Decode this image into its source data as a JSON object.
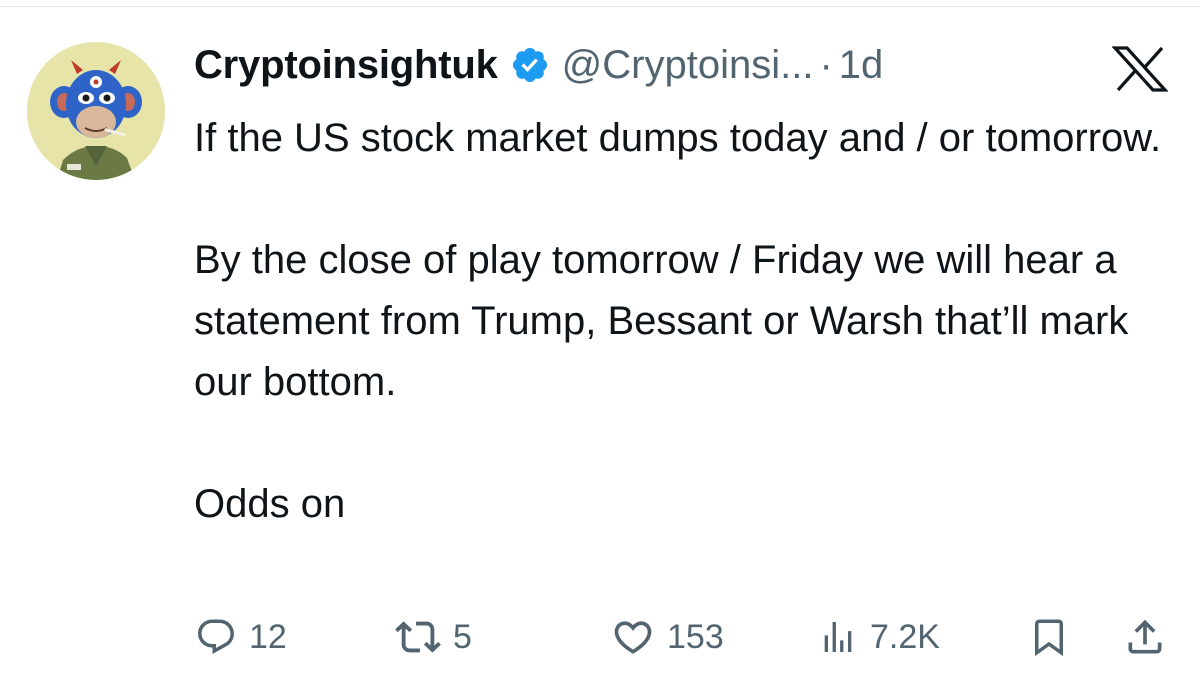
{
  "tweet": {
    "author_name": "Cryptoinsightuk",
    "handle": "@Cryptoinsi...",
    "separator": "·",
    "time": "1d",
    "paragraphs": [
      "If the US stock market dumps today and / or tomorrow.",
      "By the close of play tomorrow / Friday we will hear a statement from Trump, Bessant or Warsh that’ll mark our bottom.",
      "Odds on"
    ]
  },
  "actions": {
    "replies": "12",
    "reposts": "5",
    "likes": "153",
    "views": "7.2K"
  },
  "icons": {
    "verified": "verified-badge-icon",
    "platform": "x-logo-icon",
    "reply": "reply-icon",
    "repost": "repost-icon",
    "like": "heart-icon",
    "views": "views-chart-icon",
    "bookmark": "bookmark-icon",
    "share": "share-icon"
  },
  "colors": {
    "text_primary": "#0f1419",
    "text_secondary": "#536471",
    "verified_blue": "#1d9bf0",
    "avatar_background": "#e6e4a9"
  }
}
